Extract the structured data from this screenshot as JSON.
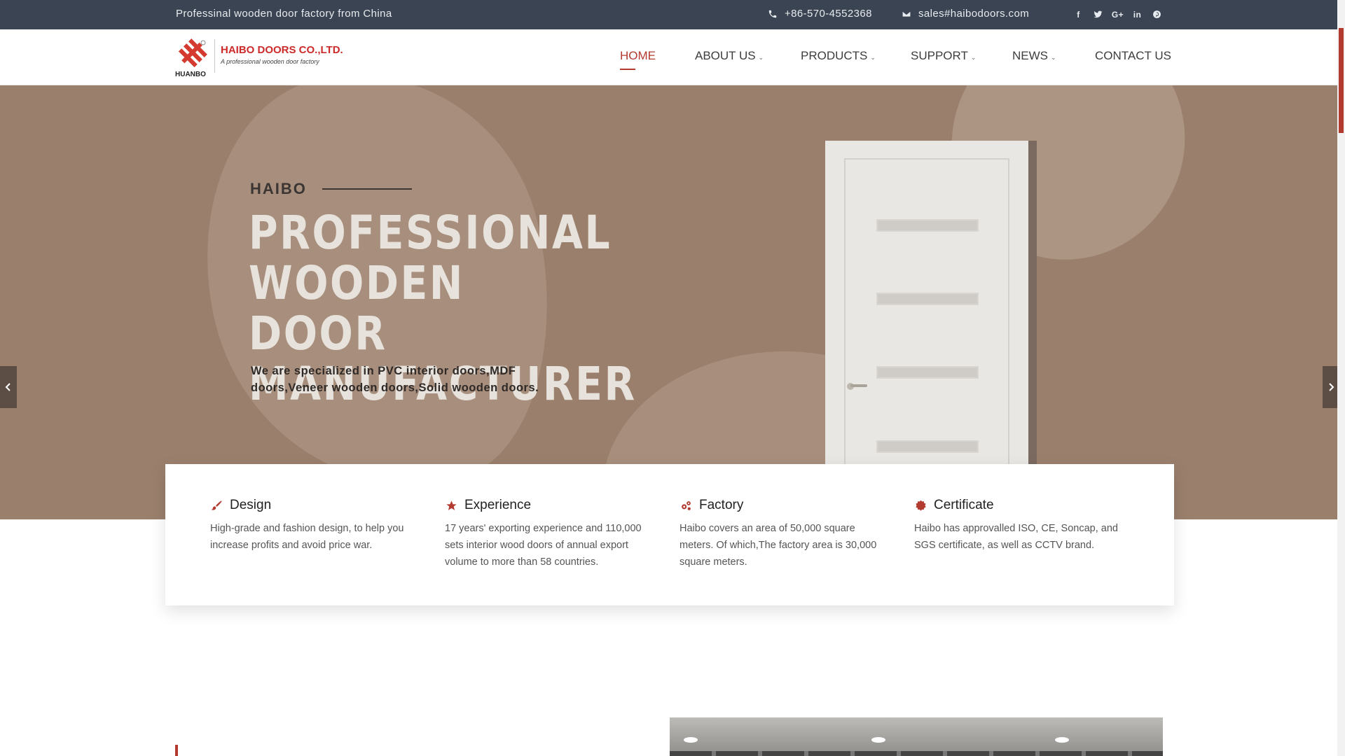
{
  "topbar": {
    "tagline": "Professinal wooden door factory from China",
    "phone": "+86-570-4552368",
    "email": "sales#haibodoors.com",
    "social": [
      "facebook-icon",
      "twitter-icon",
      "google-plus-icon",
      "linkedin-icon",
      "pinterest-icon"
    ],
    "social_labels": {
      "facebook": "f",
      "twitter": "t",
      "google": "G+",
      "linkedin": "in",
      "pinterest": "p"
    }
  },
  "header": {
    "logo": {
      "brand_small": "HUANBO",
      "company": "HAIBO DOORS CO.,LTD.",
      "slogan": "A professional wooden door factory"
    },
    "nav": [
      {
        "label": "HOME",
        "active": true,
        "dropdown": false
      },
      {
        "label": "ABOUT US",
        "active": false,
        "dropdown": true
      },
      {
        "label": "PRODUCTS",
        "active": false,
        "dropdown": true
      },
      {
        "label": "SUPPORT",
        "active": false,
        "dropdown": true
      },
      {
        "label": "NEWS",
        "active": false,
        "dropdown": true
      },
      {
        "label": "CONTACT US",
        "active": false,
        "dropdown": false
      }
    ]
  },
  "hero": {
    "kicker": "HAIBO",
    "title_line1": "PROFESSIONAL WOODEN",
    "title_line2": "DOOR MANUFACTURER",
    "description": "We are specialized in PVC interior doors,MDF doors,Veneer wooden doors,Solid wooden doors."
  },
  "features": [
    {
      "icon": "brush-icon",
      "title": "Design",
      "text": "High-grade and fashion design, to help you increase profits and avoid price war."
    },
    {
      "icon": "star-icon",
      "title": "Experience",
      "text": "17 years' exporting experience and 110,000 sets interior wood doors of annual export volume to more than 58 countries."
    },
    {
      "icon": "gears-icon",
      "title": "Factory",
      "text": "Haibo covers an area of 50,000 square meters. Of which,The factory area is 30,000 square meters."
    },
    {
      "icon": "certificate-icon",
      "title": "Certificate",
      "text": "Haibo has approvalled ISO, CE, Soncap, and SGS certificate, as well as CCTV brand."
    }
  ],
  "colors": {
    "accent": "#b33a2f",
    "topbar": "#3a4452",
    "hero_bg": "#9a7f6c"
  }
}
